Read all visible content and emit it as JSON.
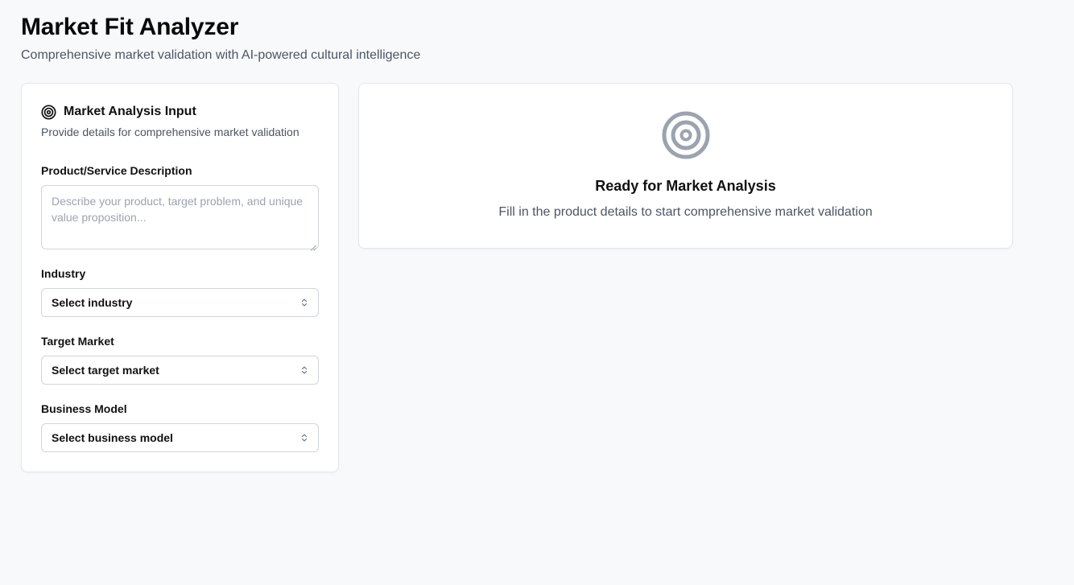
{
  "header": {
    "title": "Market Fit Analyzer",
    "subtitle": "Comprehensive market validation with AI-powered cultural intelligence"
  },
  "input_card": {
    "icon": "target-icon",
    "title": "Market Analysis Input",
    "description": "Provide details for comprehensive market validation",
    "product": {
      "label": "Product/Service Description",
      "value": "",
      "placeholder": "Describe your product, target problem, and unique value proposition..."
    },
    "industry": {
      "label": "Industry",
      "selected": "Select industry"
    },
    "target_market": {
      "label": "Target Market",
      "selected": "Select target market"
    },
    "business_model": {
      "label": "Business Model",
      "selected": "Select business model"
    }
  },
  "result_card": {
    "icon": "target-icon",
    "title": "Ready for Market Analysis",
    "description": "Fill in the product details to start comprehensive market validation"
  },
  "colors": {
    "background": "#f8f9fb",
    "card": "#ffffff",
    "border": "#e5e7eb",
    "muted_text": "#4b5563",
    "placeholder": "#9ca3af",
    "icon_gray": "#9ca3af"
  }
}
